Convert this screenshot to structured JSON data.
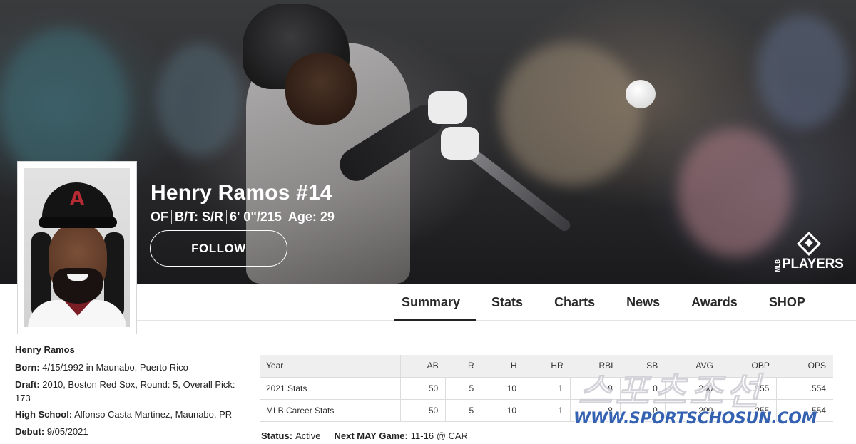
{
  "player": {
    "name_number": "Henry Ramos #14",
    "position": "OF",
    "bats_throws": "B/T: S/R",
    "height_weight": "6' 0\"/215",
    "age": "Age: 29",
    "follow_label": "FOLLOW"
  },
  "brand": {
    "players_logo_text": "PLAYERS",
    "players_logo_mlb": "MLB"
  },
  "tabs": [
    {
      "label": "Summary",
      "active": true
    },
    {
      "label": "Stats",
      "active": false
    },
    {
      "label": "Charts",
      "active": false
    },
    {
      "label": "News",
      "active": false
    },
    {
      "label": "Awards",
      "active": false
    },
    {
      "label": "SHOP",
      "active": false
    }
  ],
  "bio": {
    "name": "Henry Ramos",
    "born_label": "Born:",
    "born_value": " 4/15/1992 in Maunabo, Puerto Rico",
    "draft_label": "Draft:",
    "draft_value": " 2010, Boston Red Sox, Round: 5, Overall Pick: 173",
    "school_label": "High School:",
    "school_value": " Alfonso Casta Martinez, Maunabo, PR",
    "debut_label": "Debut:",
    "debut_value": " 9/05/2021"
  },
  "stats": {
    "headers": [
      "Year",
      "AB",
      "R",
      "H",
      "HR",
      "RBI",
      "SB",
      "AVG",
      "OBP",
      "OPS"
    ],
    "rows": [
      [
        "2021 Stats",
        "50",
        "5",
        "10",
        "1",
        "8",
        "0",
        ".200",
        ".255",
        ".554"
      ],
      [
        "MLB Career Stats",
        "50",
        "5",
        "10",
        "1",
        "8",
        "0",
        ".200",
        ".255",
        ".554"
      ]
    ]
  },
  "status": {
    "status_label": "Status:",
    "status_value": "Active",
    "next_label": "Next MAY Game:",
    "next_value": "11-16 @ CAR"
  },
  "watermark": {
    "big": "스포츠조선",
    "url": "WWW.SPORTSCHOSUN.COM"
  },
  "colors": {
    "accent": "#222222",
    "watermark_blue": "#3461b0",
    "dbacks_red": "#b42b34"
  }
}
